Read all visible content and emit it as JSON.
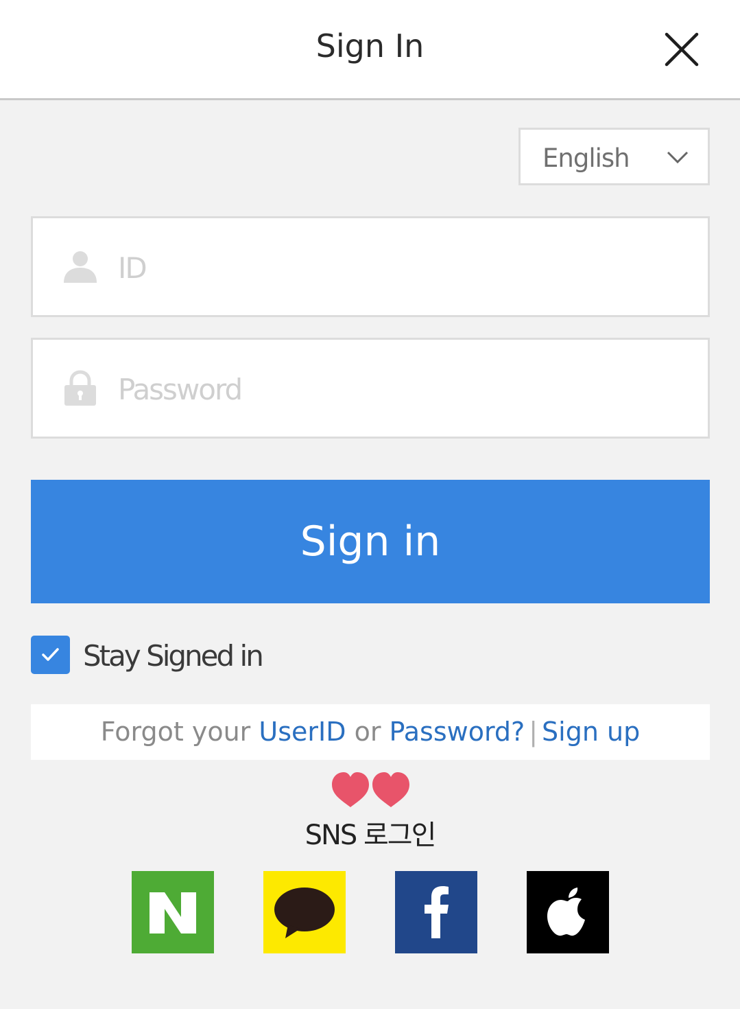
{
  "header": {
    "title": "Sign In",
    "close_icon": "close-icon"
  },
  "language": {
    "selected": "English",
    "icon": "chevron-down-icon"
  },
  "form": {
    "id_placeholder": "ID",
    "password_placeholder": "Password",
    "id_icon": "user-icon",
    "password_icon": "lock-icon",
    "submit_label": "Sign in"
  },
  "stay_signed_in": {
    "label": "Stay Signed in",
    "checked": true
  },
  "help_links": {
    "prefix": "Forgot your",
    "userid": "UserID",
    "or": "or",
    "password": "Password?",
    "separator": "|",
    "signup": "Sign up"
  },
  "sns": {
    "label": "SNS 로그인",
    "decoration": "hearts-icon",
    "providers": [
      {
        "name": "Naver",
        "icon": "naver-icon",
        "color": "#4eab35"
      },
      {
        "name": "Kakao",
        "icon": "kakao-icon",
        "color": "#fde900"
      },
      {
        "name": "Facebook",
        "icon": "facebook-icon",
        "color": "#21478a"
      },
      {
        "name": "Apple",
        "icon": "apple-icon",
        "color": "#000000"
      }
    ]
  },
  "colors": {
    "accent": "#3785e0",
    "link": "#2a6fc0",
    "background": "#f2f2f2",
    "heart": "#e8546a"
  }
}
